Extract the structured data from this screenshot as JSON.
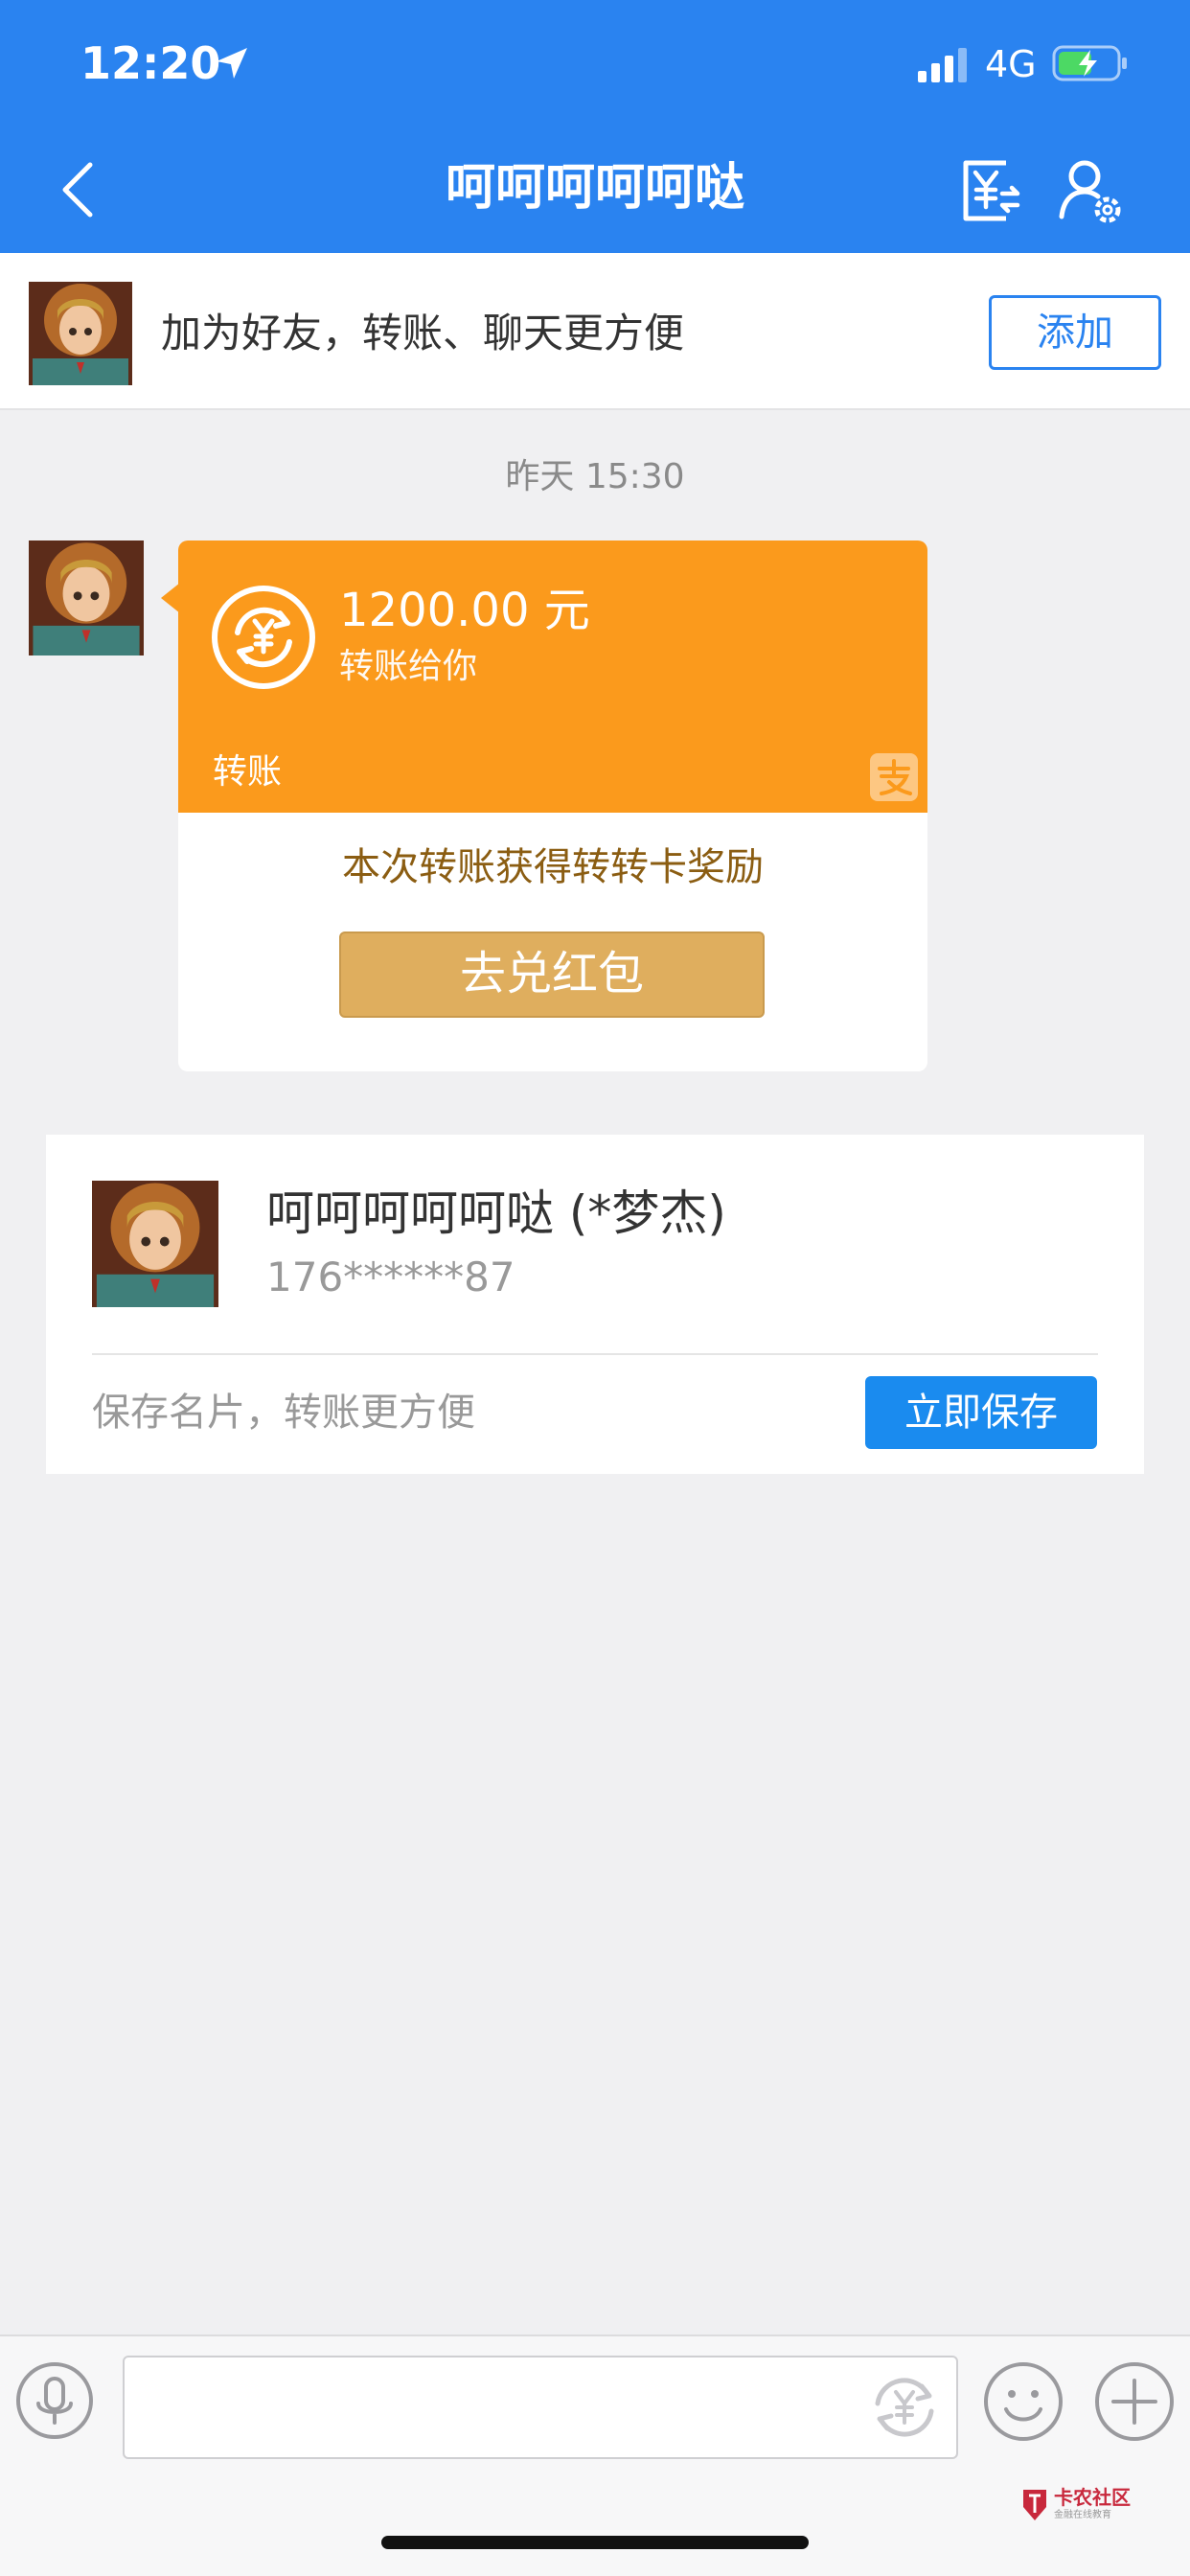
{
  "status_bar": {
    "time": "12:20",
    "network": "4G"
  },
  "header": {
    "title": "呵呵呵呵呵哒"
  },
  "add_friend": {
    "text": "加为好友，转账、聊天更方便",
    "button_label": "添加"
  },
  "chat": {
    "timestamp": "昨天 15:30",
    "transfer": {
      "amount": "1200.00 元",
      "subtitle": "转账给你",
      "label": "转账",
      "reward_text": "本次转账获得转转卡奖励",
      "redeem_label": "去兑红包"
    }
  },
  "contact_card": {
    "name": "呵呵呵呵呵哒 (*梦杰)",
    "phone": "176******87",
    "tip": "保存名片，转账更方便",
    "save_label": "立即保存"
  },
  "input_bar": {
    "placeholder": ""
  },
  "watermark": {
    "brand": "卡农社区",
    "subtitle": "金融在线教育"
  },
  "colors": {
    "header_blue": "#2a83f0",
    "transfer_orange": "#fb9a1c",
    "redeem_gold": "#dfae5e",
    "save_blue": "#1a8bef"
  }
}
